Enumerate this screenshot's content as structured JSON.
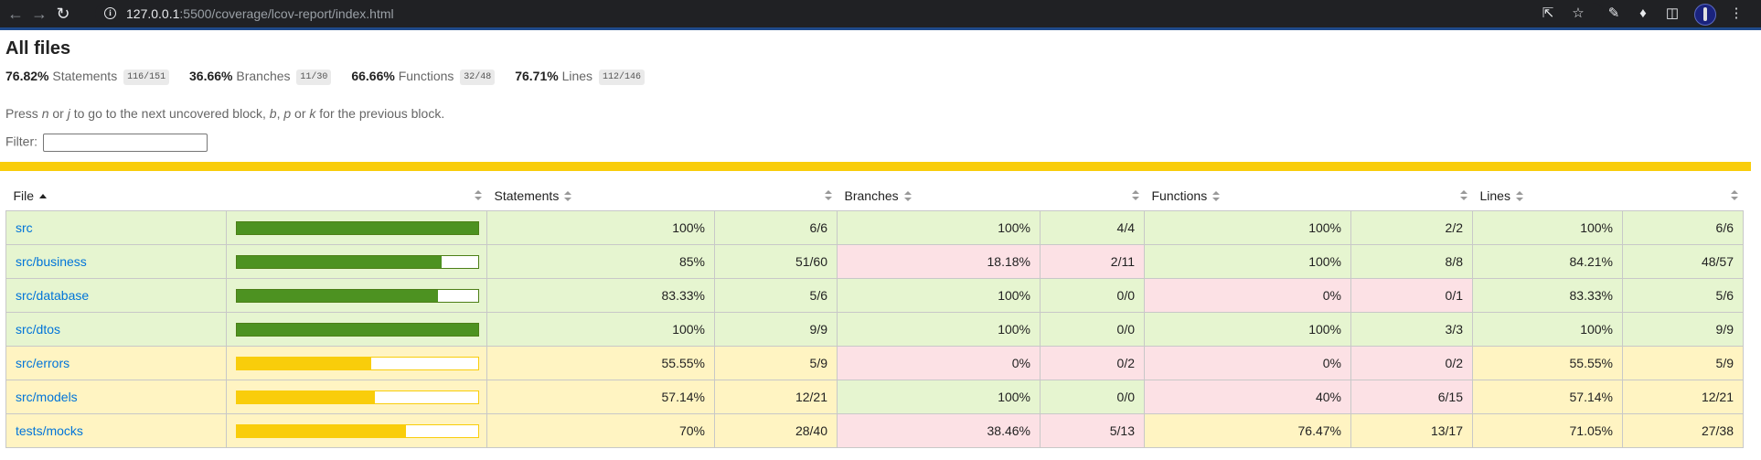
{
  "browser": {
    "url_host": "127.0.0.1",
    "url_path": ":5500/coverage/lcov-report/index.html"
  },
  "page": {
    "title": "All files",
    "summary": [
      {
        "pct": "76.82%",
        "label": "Statements",
        "fraction": "116/151"
      },
      {
        "pct": "36.66%",
        "label": "Branches",
        "fraction": "11/30"
      },
      {
        "pct": "66.66%",
        "label": "Functions",
        "fraction": "32/48"
      },
      {
        "pct": "76.71%",
        "label": "Lines",
        "fraction": "112/146"
      }
    ],
    "hint": {
      "t1": "Press ",
      "k1": "n",
      "t2": " or ",
      "k2": "j",
      "t3": " to go to the next uncovered block, ",
      "k3": "b",
      "t4": ", ",
      "k4": "p",
      "t5": " or ",
      "k5": "k",
      "t6": " for the previous block."
    },
    "filter_label": "Filter:",
    "filter_value": ""
  },
  "table": {
    "headers": [
      "File",
      "Statements",
      "Branches",
      "Functions",
      "Lines"
    ],
    "rows": [
      {
        "file": "src",
        "level": "high",
        "coverage": 1.0,
        "statements": {
          "pct": "100%",
          "frac": "6/6",
          "level": "high"
        },
        "branches": {
          "pct": "100%",
          "frac": "4/4",
          "level": "high"
        },
        "functions": {
          "pct": "100%",
          "frac": "2/2",
          "level": "high"
        },
        "lines": {
          "pct": "100%",
          "frac": "6/6",
          "level": "high"
        }
      },
      {
        "file": "src/business",
        "level": "high",
        "coverage": 0.85,
        "statements": {
          "pct": "85%",
          "frac": "51/60",
          "level": "high"
        },
        "branches": {
          "pct": "18.18%",
          "frac": "2/11",
          "level": "low"
        },
        "functions": {
          "pct": "100%",
          "frac": "8/8",
          "level": "high"
        },
        "lines": {
          "pct": "84.21%",
          "frac": "48/57",
          "level": "high"
        }
      },
      {
        "file": "src/database",
        "level": "high",
        "coverage": 0.8333,
        "statements": {
          "pct": "83.33%",
          "frac": "5/6",
          "level": "high"
        },
        "branches": {
          "pct": "100%",
          "frac": "0/0",
          "level": "high"
        },
        "functions": {
          "pct": "0%",
          "frac": "0/1",
          "level": "low"
        },
        "lines": {
          "pct": "83.33%",
          "frac": "5/6",
          "level": "high"
        }
      },
      {
        "file": "src/dtos",
        "level": "high",
        "coverage": 1.0,
        "statements": {
          "pct": "100%",
          "frac": "9/9",
          "level": "high"
        },
        "branches": {
          "pct": "100%",
          "frac": "0/0",
          "level": "high"
        },
        "functions": {
          "pct": "100%",
          "frac": "3/3",
          "level": "high"
        },
        "lines": {
          "pct": "100%",
          "frac": "9/9",
          "level": "high"
        }
      },
      {
        "file": "src/errors",
        "level": "medium",
        "coverage": 0.5555,
        "statements": {
          "pct": "55.55%",
          "frac": "5/9",
          "level": "medium"
        },
        "branches": {
          "pct": "0%",
          "frac": "0/2",
          "level": "low"
        },
        "functions": {
          "pct": "0%",
          "frac": "0/2",
          "level": "low"
        },
        "lines": {
          "pct": "55.55%",
          "frac": "5/9",
          "level": "medium"
        }
      },
      {
        "file": "src/models",
        "level": "medium",
        "coverage": 0.5714,
        "statements": {
          "pct": "57.14%",
          "frac": "12/21",
          "level": "medium"
        },
        "branches": {
          "pct": "100%",
          "frac": "0/0",
          "level": "high"
        },
        "functions": {
          "pct": "40%",
          "frac": "6/15",
          "level": "low"
        },
        "lines": {
          "pct": "57.14%",
          "frac": "12/21",
          "level": "medium"
        }
      },
      {
        "file": "tests/mocks",
        "level": "medium",
        "coverage": 0.7,
        "statements": {
          "pct": "70%",
          "frac": "28/40",
          "level": "medium"
        },
        "branches": {
          "pct": "38.46%",
          "frac": "5/13",
          "level": "low"
        },
        "functions": {
          "pct": "76.47%",
          "frac": "13/17",
          "level": "medium"
        },
        "lines": {
          "pct": "71.05%",
          "frac": "27/38",
          "level": "medium"
        }
      }
    ]
  }
}
